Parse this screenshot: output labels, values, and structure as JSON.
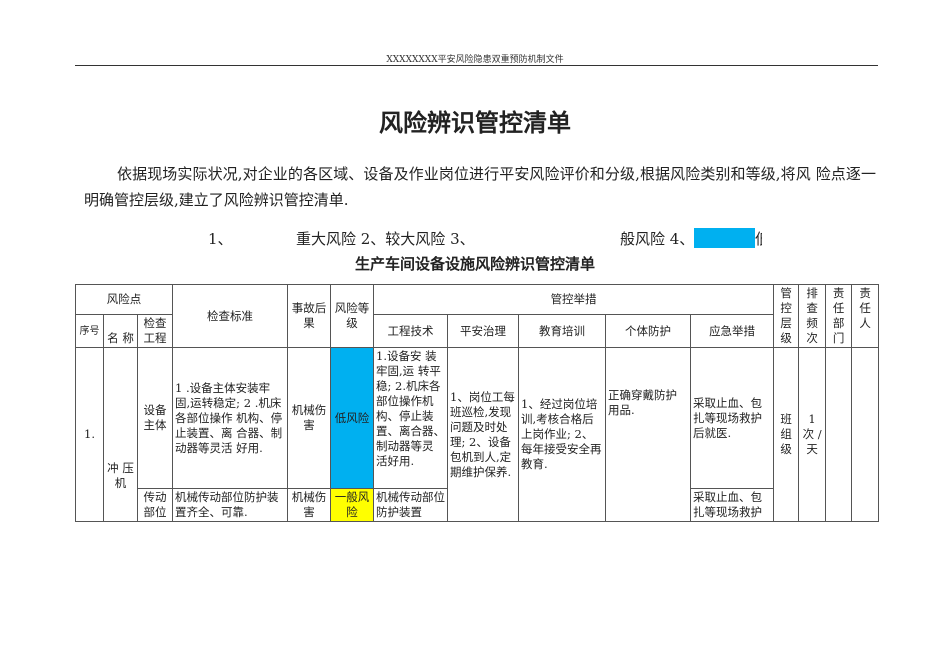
{
  "header": "XXXXXXXX平安风险隐患双重预防机制文件",
  "title": "风险辨识管控清单",
  "intro": "依据现场实际状况,对企业的各区域、设备及作业岗位进行平安风险评价和分级,根据风险类别和等级,将风 险点逐一明确管控层级,建立了风险辨识管控清单.",
  "levels": {
    "a": "1、",
    "b": "重大风险 2、较大风险 3、",
    "c": "般风险 4、",
    "d": "低"
  },
  "colors": {
    "low": "#00b0f0",
    "general": "#ffff00"
  },
  "table_title": "生产车间设备设施风险辨识管控清单",
  "headers": {
    "risk_point": "风险点",
    "seq": "序号",
    "name": "名 称",
    "item": "检查工程",
    "standard": "检查标准",
    "consequence": "事故后果",
    "level": "风险等级",
    "measures": "管控举措",
    "eng": "工程技术",
    "safety": "平安治理",
    "edu": "教育培训",
    "ppe": "个体防护",
    "emerg": "应急举措",
    "ctrl": "管控层级",
    "freq": "排查频次",
    "dept": "责任部门",
    "person": "责任人"
  },
  "rows": [
    {
      "seq": "1.",
      "name": "冲 压 机",
      "item": "设备主体",
      "standard": "1 .设备主体安装牢 固,运转稳定; 2 .机床各部位操作 机构、停止装置、离 合器、制动器等灵活 好用.",
      "consequence": "机械伤害",
      "level": "低风险",
      "eng": "1.设备安 装牢固,运 转平稳; 2.机床各 部位操作机 构、停止装 置、离合器、 制动器等灵 活好用.",
      "safety": "1、岗位工每班巡检,发现问题及时处理; 2、设备包机到人,定期维护保养.",
      "edu": "1、经过岗位培训,考核合格后上岗作业; 2、每年接受安全再教育.",
      "ppe": "正确穿戴防护用品.",
      "emerg": "采取止血、包扎等现场救护后就医.",
      "ctrl": "班组级",
      "freq": "1 次 / 天"
    },
    {
      "item": "传动部位",
      "standard": "机械传动部位防护装置齐全、可靠.",
      "consequence": "机械伤害",
      "level": "一般风险",
      "eng": "机械传动部位防护装置",
      "emerg": "采取止血、包扎等现场救护"
    }
  ]
}
